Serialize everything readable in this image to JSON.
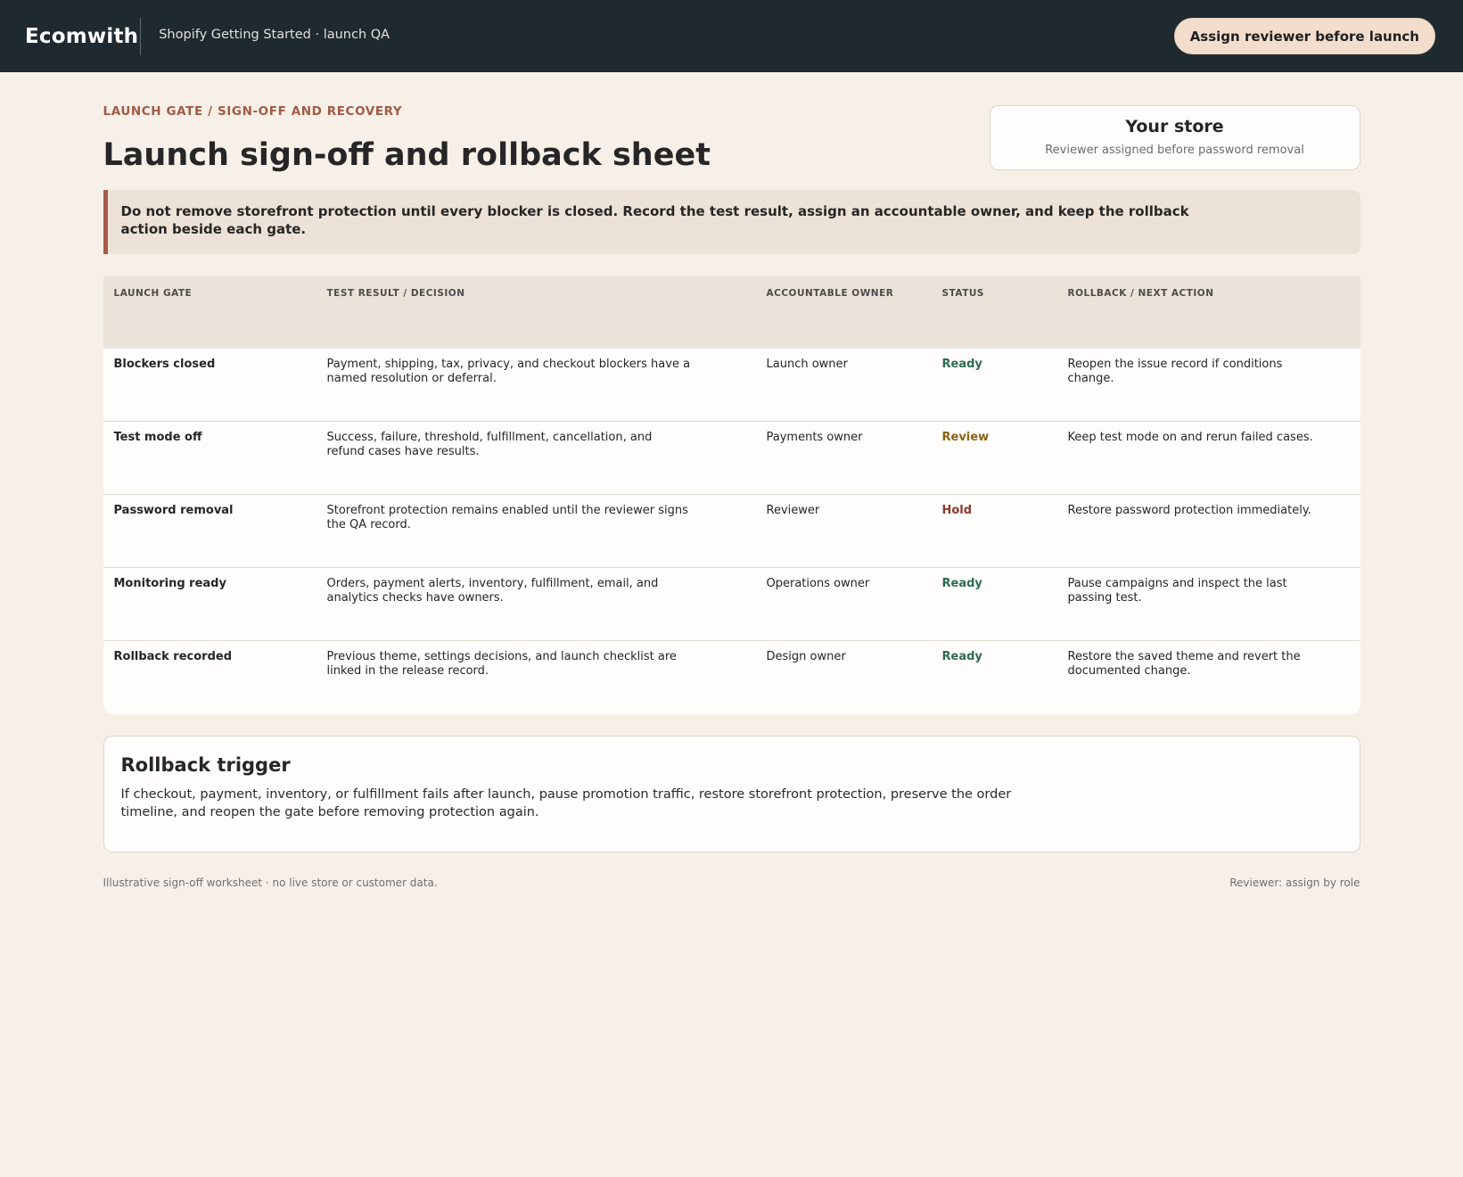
{
  "app": {
    "brand": "Ecomwith",
    "subtitle": "Shopify Getting Started · launch QA",
    "assign_button": "Assign reviewer before launch"
  },
  "header": {
    "eyebrow": "LAUNCH GATE / SIGN-OFF AND RECOVERY",
    "title": "Launch sign-off and rollback sheet"
  },
  "store_card": {
    "name": "Your store",
    "note": "Reviewer assigned before password removal"
  },
  "warning": "Do not remove storefront protection until every blocker is closed. Record the test result, assign an accountable owner, and keep the rollback action beside each gate.",
  "table": {
    "columns": [
      "LAUNCH GATE",
      "TEST RESULT / DECISION",
      "ACCOUNTABLE OWNER",
      "STATUS",
      "ROLLBACK / NEXT ACTION"
    ],
    "rows": [
      {
        "gate": "Blockers closed",
        "result": "Payment, shipping, tax, privacy, and checkout blockers have a named resolution or deferral.",
        "owner": "Launch owner",
        "status": "Ready",
        "action": "Reopen the issue record if conditions change."
      },
      {
        "gate": "Test mode off",
        "result": "Success, failure, threshold, fulfillment, cancellation, and refund cases have results.",
        "owner": "Payments owner",
        "status": "Review",
        "action": "Keep test mode on and rerun failed cases."
      },
      {
        "gate": "Password removal",
        "result": "Storefront protection remains enabled until the reviewer signs the QA record.",
        "owner": "Reviewer",
        "status": "Hold",
        "action": "Restore password protection immediately."
      },
      {
        "gate": "Monitoring ready",
        "result": "Orders, payment alerts, inventory, fulfillment, email, and analytics checks have owners.",
        "owner": "Operations owner",
        "status": "Ready",
        "action": "Pause campaigns and inspect the last passing test."
      },
      {
        "gate": "Rollback recorded",
        "result": "Previous theme, settings decisions, and launch checklist are linked in the release record.",
        "owner": "Design owner",
        "status": "Ready",
        "action": "Restore the saved theme and revert the documented change."
      }
    ]
  },
  "status_colors": {
    "Ready": "#2f6b4f",
    "Review": "#8a6414",
    "Hold": "#8e3a2e"
  },
  "trigger": {
    "title": "Rollback trigger",
    "text": "If checkout, payment, inventory, or fulfillment fails after launch, pause promotion traffic, restore storefront protection, preserve the order timeline, and reopen the gate before removing protection again."
  },
  "footer": {
    "left": "Illustrative sign-off worksheet · no live store or customer data.",
    "right": "Reviewer: assign by role"
  }
}
